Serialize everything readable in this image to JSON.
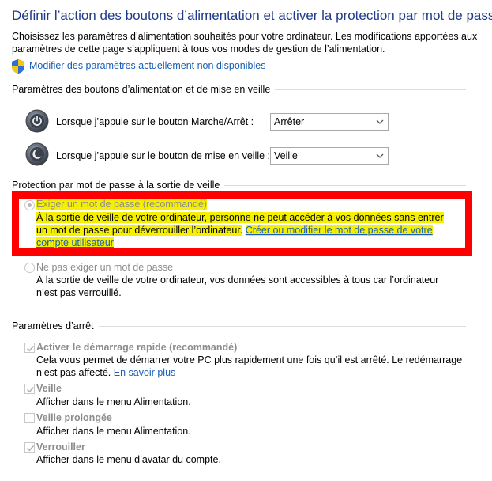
{
  "title": "Définir l’action des boutons d’alimentation et activer la protection par mot de passe",
  "intro": "Choisissez les paramètres d’alimentation souhaités pour votre ordinateur. Les modifications apportées aux paramètres de cette page s’appliquent à tous vos modes de gestion de l’alimentation.",
  "change_settings_link": "Modifier des paramètres actuellement non disponibles",
  "power_buttons": {
    "section_label": "Paramètres des boutons d’alimentation et de mise en veille",
    "power_button_label": "Lorsque j’appuie sur le bouton Marche/Arrêt :",
    "power_button_value": "Arrêter",
    "sleep_button_label": "Lorsque j’appuie sur le bouton de mise en veille :",
    "sleep_button_value": "Veille"
  },
  "password_protection": {
    "section_label": "Protection par mot de passe à la sortie de veille",
    "require_label": "Exiger un mot de passe (recommandé)",
    "require_desc": "À la sortie de veille de votre ordinateur, personne ne peut accéder à vos données sans entrer un mot de passe pour déverrouiller l’ordinateur.",
    "require_link": "Créer ou modifier le mot de passe de votre compte utilisateur",
    "no_require_label": "Ne pas exiger un mot de passe",
    "no_require_desc": "À la sortie de veille de votre ordinateur, vos données sont accessibles à tous car l’ordinateur n’est pas verrouillé.",
    "require_selected": true
  },
  "shutdown": {
    "section_label": "Paramètres d’arrêt",
    "fast_startup_label": "Activer le démarrage rapide (recommandé)",
    "fast_startup_desc": "Cela vous permet de démarrer votre PC plus rapidement une fois qu’il est arrêté. Le redémarrage n’est pas affecté.",
    "fast_startup_link": "En savoir plus",
    "fast_startup_checked": true,
    "sleep_label": "Veille",
    "sleep_desc": "Afficher dans le menu Alimentation.",
    "sleep_checked": true,
    "hibernate_label": "Veille prolongée",
    "hibernate_desc": "Afficher dans le menu Alimentation.",
    "hibernate_checked": false,
    "lock_label": "Verrouiller",
    "lock_desc": "Afficher dans le menu d’avatar du compte.",
    "lock_checked": true
  },
  "colors": {
    "title": "#1e3a8a",
    "link": "#1a5fb4",
    "highlight": "#f5f000",
    "annotation_box": "#ff0000"
  },
  "icons": [
    "uac-shield-icon",
    "power-button-icon",
    "sleep-button-icon",
    "chevron-down-icon",
    "checkmark-icon"
  ]
}
